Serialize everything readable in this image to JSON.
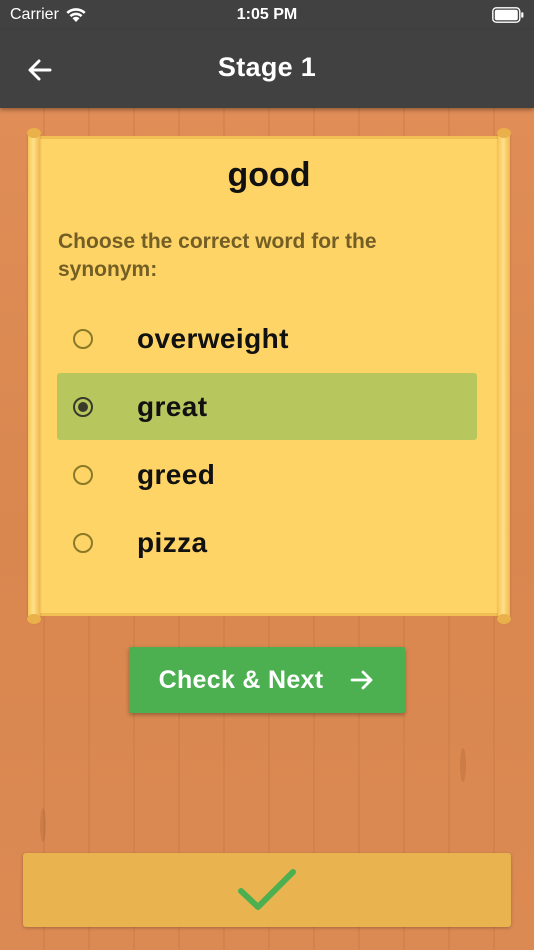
{
  "status_bar": {
    "carrier": "Carrier",
    "time": "1:05 PM",
    "wifi_icon": "wifi-icon",
    "battery_icon": "battery-icon"
  },
  "app_bar": {
    "title": "Stage 1",
    "back_icon": "arrow-left-icon",
    "background_color": "#414141"
  },
  "quiz": {
    "word": "good",
    "instruction": "Choose the correct word for the synonym:",
    "options": [
      {
        "label": "overweight",
        "selected": false
      },
      {
        "label": "great",
        "selected": true
      },
      {
        "label": "greed",
        "selected": false
      },
      {
        "label": "pizza",
        "selected": false
      }
    ],
    "selected_highlight_color": "#b8c65e",
    "paper_color": "#ffd466"
  },
  "actions": {
    "check_next_label": "Check & Next",
    "check_next_icon": "arrow-right-icon",
    "button_color": "#4caf50"
  },
  "answer_bar": {
    "status_icon": "check-mark-icon",
    "check_color": "#4caf50",
    "bar_color": "#e9b450"
  }
}
